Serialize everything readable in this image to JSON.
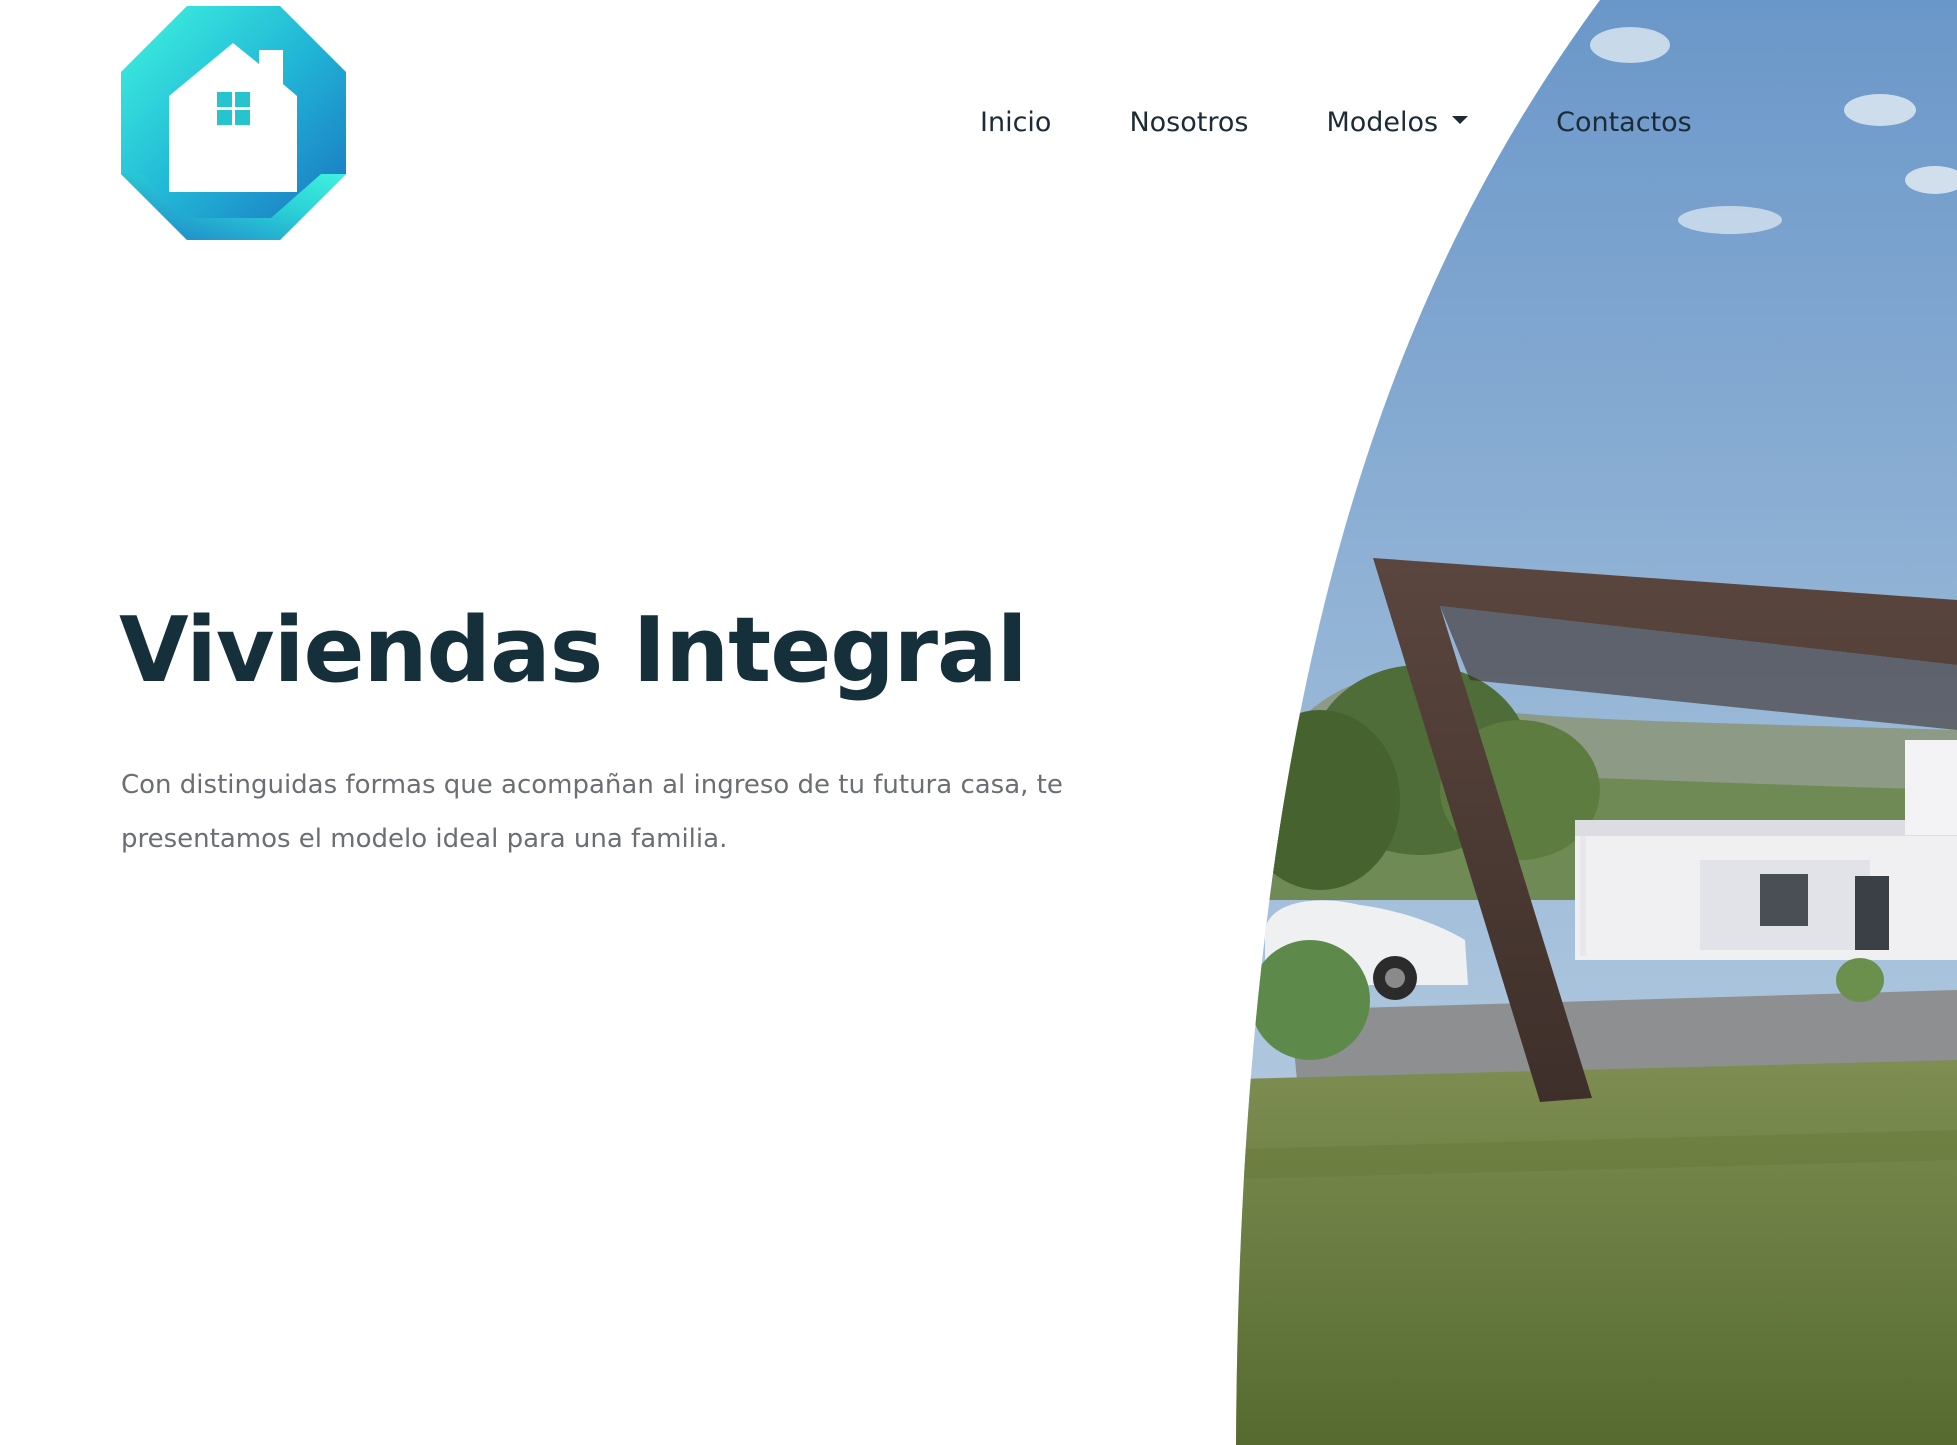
{
  "brand": {
    "logo_icon": "house-octagon-logo",
    "gradient_colors": [
      "#2fe6d6",
      "#1e7ec8",
      "#3ef0dc"
    ]
  },
  "nav": {
    "items": [
      {
        "label": "Inicio"
      },
      {
        "label": "Nosotros"
      },
      {
        "label": "Modelos",
        "has_dropdown": true
      },
      {
        "label": "Contactos"
      }
    ],
    "dropdown_icon": "caret-down-icon"
  },
  "hero": {
    "title": "Viviendas Integral",
    "description": "Con distinguidas formas que acompañan al ingreso de tu futura casa, te presentamos el modelo ideal para una familia."
  },
  "colors": {
    "title": "#16303b",
    "nav_text": "#1c2b35",
    "body_text": "#6b6f73"
  }
}
